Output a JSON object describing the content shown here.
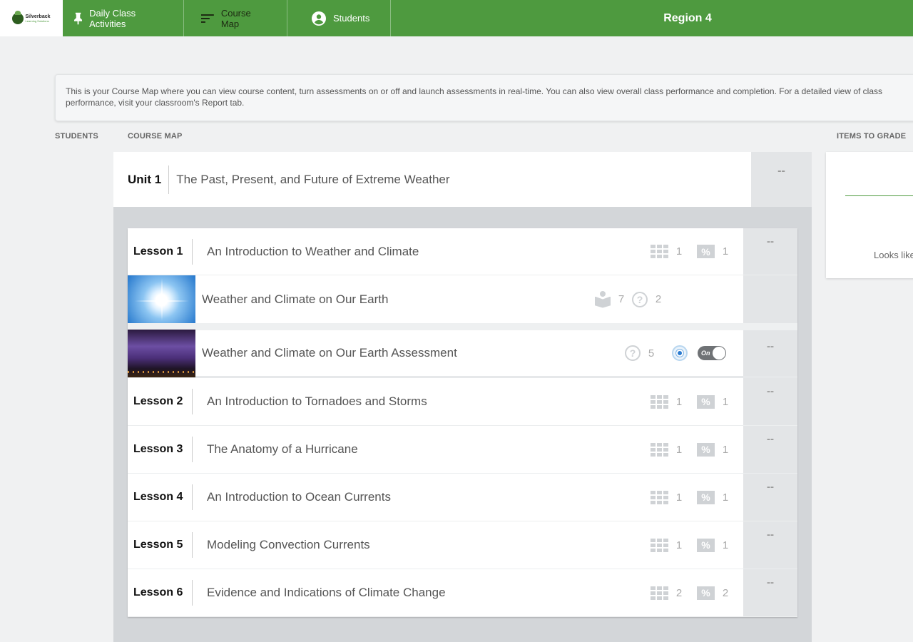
{
  "nav": {
    "logo_text": "Silverback",
    "logo_sub": "Learning Solutions",
    "daily_label": "Daily Class Activities",
    "coursemap_label": "Course Map",
    "students_label": "Students",
    "title": "Region 4"
  },
  "info_text": "This is your Course Map where you can view course content, turn assessments on or off and launch assessments in real-time. You can also view overall class performance and completion. For a detailed view of class performance, visit your classroom's Report tab.",
  "labels": {
    "students": "STUDENTS",
    "course_map": "COURSE MAP",
    "items_to_grade": "ITEMS TO GRADE"
  },
  "unit": {
    "number": "Unit 1",
    "name": "The Past, Present, and Future of Extreme Weather",
    "score": "--"
  },
  "lesson1": {
    "number": "Lesson 1",
    "name": "An Introduction to Weather and Climate",
    "grid_count": "1",
    "pct_count": "1",
    "score": "--"
  },
  "activity1": {
    "name": "Weather and Climate on Our Earth",
    "reading_count": "7",
    "question_count": "2"
  },
  "activity2": {
    "name": "Weather and Climate on Our Earth Assessment",
    "question_count": "5",
    "toggle_label": "On",
    "score": "--"
  },
  "lessons": [
    {
      "number": "Lesson 2",
      "name": "An Introduction to Tornadoes and Storms",
      "grid_count": "1",
      "pct_count": "1",
      "score": "--"
    },
    {
      "number": "Lesson 3",
      "name": "The Anatomy of a Hurricane",
      "grid_count": "1",
      "pct_count": "1",
      "score": "--"
    },
    {
      "number": "Lesson 4",
      "name": "An Introduction to Ocean Currents",
      "grid_count": "1",
      "pct_count": "1",
      "score": "--"
    },
    {
      "number": "Lesson 5",
      "name": "Modeling Convection Currents",
      "grid_count": "1",
      "pct_count": "1",
      "score": "--"
    },
    {
      "number": "Lesson 6",
      "name": "Evidence and Indications of Climate Change",
      "grid_count": "2",
      "pct_count": "2",
      "score": "--"
    }
  ],
  "grade_panel": {
    "message": "Looks like"
  },
  "icons": {
    "pct_symbol": "%",
    "question_symbol": "?"
  },
  "colors": {
    "brand_green": "#4e9a3f",
    "panel_gray": "#d3d6d9",
    "score_gray": "#e3e5e7"
  }
}
